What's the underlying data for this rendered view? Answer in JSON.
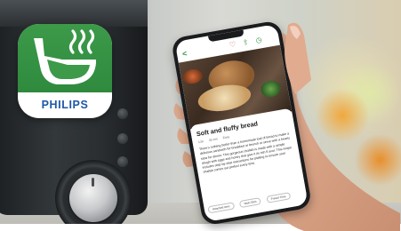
{
  "brand": {
    "name": "PHILIPS",
    "icon": "pot-steam-icon",
    "green": "#2f8a3e",
    "blue": "#1f57a6"
  },
  "app": {
    "topbar": {
      "back_icon": "back-arrow-icon",
      "icons": [
        "heart-icon",
        "share-icon",
        "timer-icon"
      ]
    },
    "recipe": {
      "title": "Soft and fluffy bread",
      "meta": [
        "3.5k",
        "35 min",
        "Easy"
      ],
      "description": "There's nothing better than a homemade loaf of bread to make a delicious sandwich for breakfast or brunch or serve with a hearty stew for dinner. This gorgeous challah is made with a simple dough with eggs and honey that give it its rich fl avor. This recipe includes step-by-step instructions for plaiting to ensure your challah comes out perfect every time."
    },
    "chips": [
      "Attached Item",
      "Main Dish",
      "Preset Time"
    ]
  }
}
